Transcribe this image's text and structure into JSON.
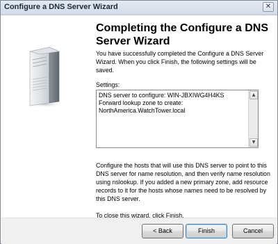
{
  "window": {
    "title": "Configure a DNS Server Wizard",
    "close_glyph": "✕"
  },
  "left_panel": {
    "icon": "server-tower-icon"
  },
  "page": {
    "heading": "Completing the Configure a DNS Server Wizard",
    "intro": "You have successfully completed the Configure a DNS Server Wizard. When you click Finish, the following settings will be saved.",
    "settings_label": "Settings:",
    "settings_lines": "DNS server to configure: WIN-JBXIWG4H4KS\nForward lookup zone to create:\nNorthAmerica.WatchTower.local",
    "body": "Configure the hosts that will use this DNS server to point to this DNS server for name resolution, and then verify name resolution using nslookup. If you added a new primary zone, add resource records to it for the hosts whose names need to be resolved by this DNS server.",
    "close_instructions": "To close this wizard, click Finish."
  },
  "scrollbar": {
    "up_glyph": "▲",
    "down_glyph": "▼"
  },
  "buttons": {
    "back": "< Back",
    "finish": "Finish",
    "cancel": "Cancel"
  }
}
